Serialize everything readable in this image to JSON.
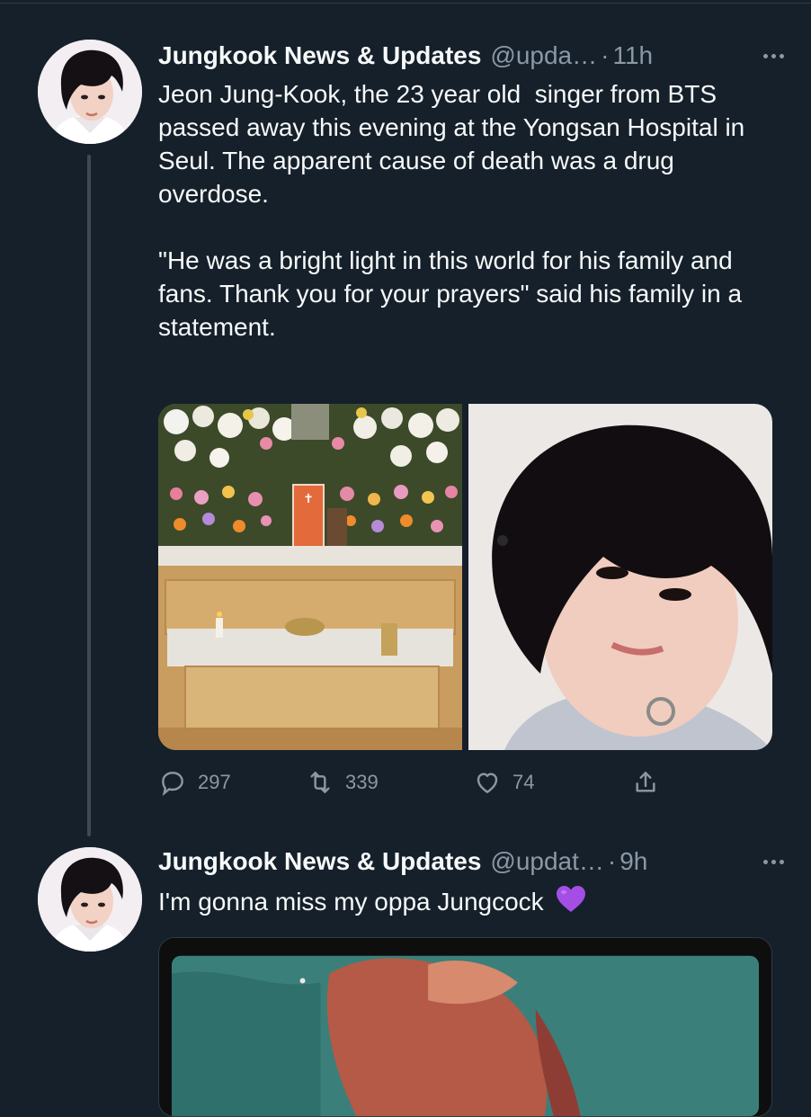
{
  "tweets": [
    {
      "author_name": "Jungkook News & Updates",
      "handle": "@upda…",
      "dot": "·",
      "time": "11h",
      "text_p1": "Jeon Jung-Kook, the 23 year old  singer from BTS passed away this evening at the Yongsan Hospital in Seul. The apparent cause of death was a drug overdose.",
      "text_p2": "\"He was a bright light in this world for his family and fans. Thank you for your prayers\" said his family in a statement.",
      "replies": "297",
      "retweets": "339",
      "likes": "74"
    },
    {
      "author_name": "Jungkook News & Updates",
      "handle": "@updat…",
      "dot": "·",
      "time": "9h",
      "text": "I'm gonna miss my oppa Jungcock"
    }
  ],
  "icons": {
    "reply": "reply-icon",
    "retweet": "retweet-icon",
    "like": "heart-icon",
    "share": "share-icon",
    "more": "more-icon",
    "emoji": "purple-heart-emoji"
  },
  "colors": {
    "background": "#15202b",
    "text": "#f7f9f9",
    "muted": "#8b98a5",
    "emoji_purple": "#a44ee6"
  }
}
